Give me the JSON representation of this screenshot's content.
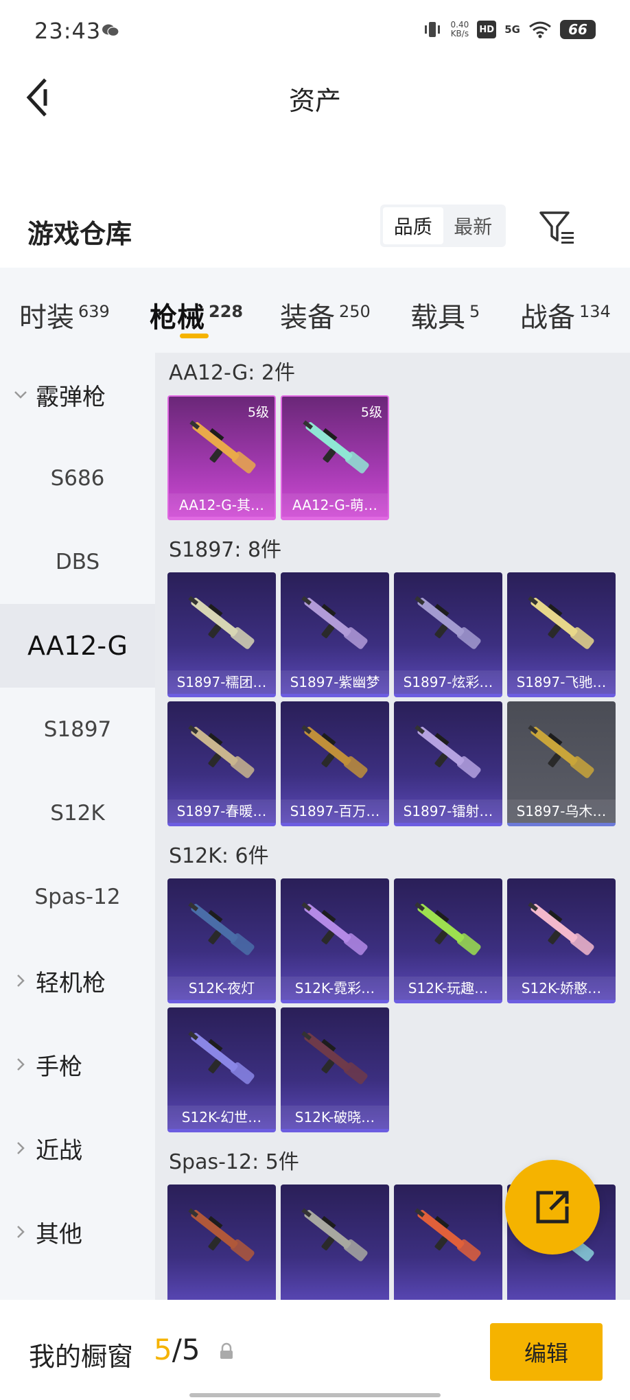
{
  "status_bar": {
    "time": "23:43",
    "net_speed_value": "0.40",
    "net_speed_unit": "KB/s",
    "hd": "HD",
    "signal": "5G",
    "battery": "66"
  },
  "nav": {
    "title": "资产"
  },
  "warehouse": {
    "title": "游戏仓库",
    "sort_quality": "品质",
    "sort_newest": "最新"
  },
  "category_tabs": [
    {
      "label": "时装",
      "count": "639"
    },
    {
      "label": "枪械",
      "count": "228"
    },
    {
      "label": "装备",
      "count": "250"
    },
    {
      "label": "载具",
      "count": "5"
    },
    {
      "label": "战备",
      "count": "134"
    }
  ],
  "sidebar": {
    "group_shotgun": "霰弹枪",
    "sub_items": [
      "S686",
      "DBS",
      "AA12-G",
      "S1897",
      "S12K",
      "Spas-12"
    ],
    "other_groups": [
      "轻机枪",
      "手枪",
      "近战",
      "其他"
    ]
  },
  "groups": [
    {
      "label": "AA12-G: 2件",
      "items": [
        {
          "name": "AA12-G-其…",
          "level": "5级",
          "style": "pink",
          "gun_color": "#e9a94a"
        },
        {
          "name": "AA12-G-萌…",
          "level": "5级",
          "style": "pink",
          "gun_color": "#8fe6d4"
        }
      ]
    },
    {
      "label": "S1897: 8件",
      "items": [
        {
          "name": "S1897-糯团…",
          "style": "purple",
          "gun_color": "#d7d5b4"
        },
        {
          "name": "S1897-紫幽梦",
          "style": "purple",
          "gun_color": "#b19bd8"
        },
        {
          "name": "S1897-炫彩…",
          "style": "purple",
          "gun_color": "#a39bd0"
        },
        {
          "name": "S1897-飞驰…",
          "style": "purple",
          "gun_color": "#e7d78a"
        },
        {
          "name": "S1897-春暖…",
          "style": "purple",
          "gun_color": "#c9b58e"
        },
        {
          "name": "S1897-百万…",
          "style": "purple",
          "gun_color": "#c08f3a"
        },
        {
          "name": "S1897-镭射…",
          "style": "purple",
          "gun_color": "#b5a2e0"
        },
        {
          "name": "S1897-乌木…",
          "style": "gray",
          "gun_color": "#c9a53a"
        }
      ]
    },
    {
      "label": "S12K: 6件",
      "items": [
        {
          "name": "S12K-夜灯",
          "style": "purple",
          "gun_color": "#4a6da8"
        },
        {
          "name": "S12K-霓彩…",
          "style": "purple",
          "gun_color": "#b48ae6"
        },
        {
          "name": "S12K-玩趣…",
          "style": "purple",
          "gun_color": "#9de04f"
        },
        {
          "name": "S12K-娇憨…",
          "style": "purple",
          "gun_color": "#f3b8cc"
        },
        {
          "name": "S12K-幻世…",
          "style": "purple",
          "gun_color": "#8a86e6"
        },
        {
          "name": "S12K-破晓…",
          "style": "purple",
          "gun_color": "#6e3a4a"
        }
      ]
    },
    {
      "label": "Spas-12: 5件",
      "items": [
        {
          "name": "",
          "style": "purple",
          "gun_color": "#b0583a"
        },
        {
          "name": "",
          "style": "purple",
          "gun_color": "#a8a8a0"
        },
        {
          "name": "",
          "style": "purple",
          "gun_color": "#e0603a"
        },
        {
          "name": "",
          "style": "purple",
          "gun_color": "#8ad0d8"
        }
      ]
    }
  ],
  "bottom": {
    "showcase_label": "我的橱窗",
    "showcase_current": "5",
    "showcase_total": "/5",
    "edit_label": "编辑"
  },
  "colors": {
    "accent": "#f5b300",
    "card_purple": "#3c2f80",
    "card_pink": "#a43ab1"
  }
}
